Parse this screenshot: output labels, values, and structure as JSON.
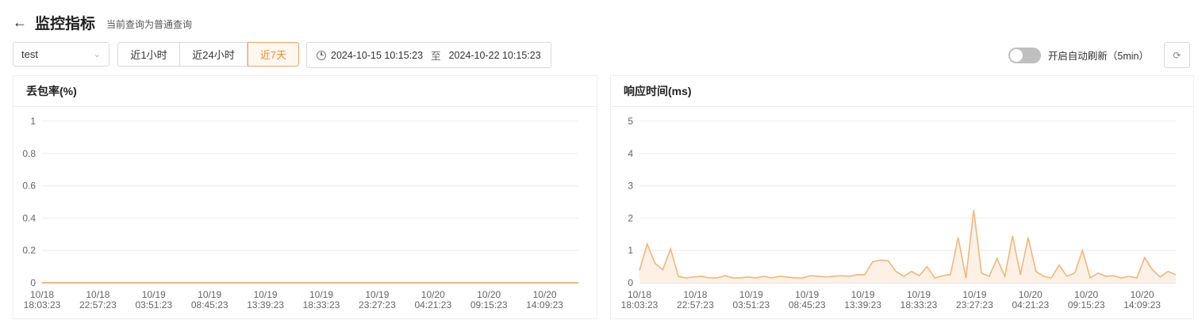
{
  "header": {
    "back_icon": "arrow-left-icon",
    "title": "监控指标",
    "subtitle": "当前查询为普通查询"
  },
  "toolbar": {
    "target_select": {
      "value": "test"
    },
    "ranges": [
      {
        "label": "近1小时",
        "active": false
      },
      {
        "label": "近24小时",
        "active": false
      },
      {
        "label": "近7天",
        "active": true
      }
    ],
    "date_range": {
      "start": "2024-10-15 10:15:23",
      "separator": "至",
      "end": "2024-10-22 10:15:23"
    },
    "auto_refresh": {
      "label": "开启自动刷新（5min）",
      "enabled": false
    },
    "refresh_icon": "refresh-icon"
  },
  "colors": {
    "accent": "#f08a2c",
    "series_line": "#f5b57a",
    "series_fill": "#fdf1e6"
  },
  "chart_data": [
    {
      "type": "line",
      "title": "丢包率(%)",
      "ylim": [
        0,
        1
      ],
      "yticks": [
        "1",
        "0.8",
        "0.6",
        "0.4",
        "0.2",
        "0"
      ],
      "xticks": [
        [
          "10/18",
          "18:03:23"
        ],
        [
          "10/18",
          "22:57:23"
        ],
        [
          "10/19",
          "03:51:23"
        ],
        [
          "10/19",
          "08:45:23"
        ],
        [
          "10/19",
          "13:39:23"
        ],
        [
          "10/19",
          "18:33:23"
        ],
        [
          "10/19",
          "23:27:23"
        ],
        [
          "10/20",
          "04:21:23"
        ],
        [
          "10/20",
          "09:15:23"
        ],
        [
          "10/20",
          "14:09:23"
        ]
      ],
      "grid": true,
      "series": [
        {
          "values": [
            0,
            0,
            0,
            0,
            0,
            0,
            0,
            0,
            0,
            0,
            0,
            0,
            0,
            0,
            0,
            0,
            0,
            0,
            0,
            0,
            0,
            0,
            0,
            0,
            0,
            0,
            0,
            0,
            0,
            0,
            0,
            0,
            0,
            0,
            0,
            0,
            0,
            0,
            0,
            0,
            0,
            0,
            0,
            0,
            0,
            0,
            0,
            0,
            0,
            0,
            0,
            0,
            0,
            0,
            0,
            0,
            0,
            0,
            0,
            0,
            0,
            0,
            0,
            0,
            0,
            0,
            0,
            0,
            0,
            0
          ]
        }
      ]
    },
    {
      "type": "area",
      "title": "响应时间(ms)",
      "ylim": [
        0,
        5
      ],
      "yticks": [
        "5",
        "4",
        "3",
        "2",
        "1",
        "0"
      ],
      "xticks": [
        [
          "10/18",
          "18:03:23"
        ],
        [
          "10/18",
          "22:57:23"
        ],
        [
          "10/19",
          "03:51:23"
        ],
        [
          "10/19",
          "08:45:23"
        ],
        [
          "10/19",
          "13:39:23"
        ],
        [
          "10/19",
          "18:33:23"
        ],
        [
          "10/19",
          "23:27:23"
        ],
        [
          "10/20",
          "04:21:23"
        ],
        [
          "10/20",
          "09:15:23"
        ],
        [
          "10/20",
          "14:09:23"
        ]
      ],
      "grid": true,
      "series": [
        {
          "values": [
            0.38,
            1.2,
            0.6,
            0.4,
            1.05,
            0.2,
            0.15,
            0.18,
            0.2,
            0.15,
            0.15,
            0.22,
            0.15,
            0.15,
            0.18,
            0.15,
            0.2,
            0.15,
            0.2,
            0.18,
            0.15,
            0.15,
            0.22,
            0.2,
            0.18,
            0.2,
            0.22,
            0.2,
            0.25,
            0.25,
            0.65,
            0.7,
            0.68,
            0.35,
            0.2,
            0.35,
            0.22,
            0.5,
            0.15,
            0.22,
            0.25,
            1.4,
            0.15,
            2.25,
            0.3,
            0.2,
            0.75,
            0.2,
            1.45,
            0.25,
            1.4,
            0.35,
            0.2,
            0.15,
            0.55,
            0.2,
            0.3,
            1.0,
            0.15,
            0.3,
            0.2,
            0.22,
            0.15,
            0.2,
            0.15,
            0.78,
            0.4,
            0.18,
            0.35,
            0.25
          ]
        }
      ]
    }
  ]
}
